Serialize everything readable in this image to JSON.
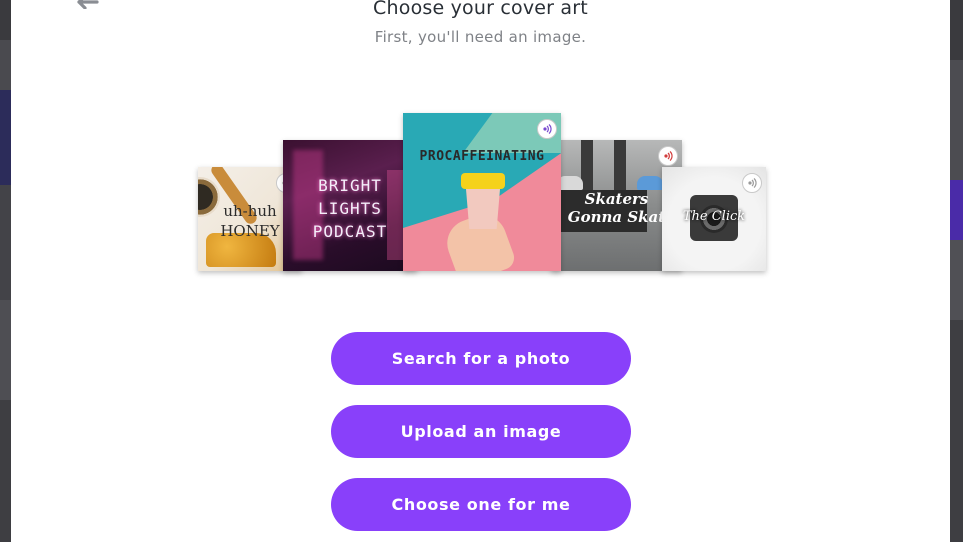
{
  "modal": {
    "title": "Choose your cover art",
    "subtitle": "First, you'll need an image."
  },
  "covers": [
    {
      "name": "honey",
      "text_lines": [
        "uh-huh",
        "HONEY"
      ]
    },
    {
      "name": "bright-lights",
      "text_lines": [
        "BRIGHT",
        "LIGHTS",
        "PODCAST"
      ]
    },
    {
      "name": "procaffeinating",
      "text_lines": [
        "PROCAFFEINATING"
      ]
    },
    {
      "name": "skaters",
      "text_lines": [
        "Skaters",
        "Gonna Skat"
      ]
    },
    {
      "name": "the-click",
      "text_lines": [
        "The Click"
      ]
    }
  ],
  "actions": {
    "search_label": "Search for a photo",
    "upload_label": "Upload an image",
    "choose_label": "Choose one for me"
  },
  "colors": {
    "accent": "#8940fa",
    "title": "#292f36",
    "subtitle": "#7f8287"
  },
  "icons": {
    "back": "arrow-left-icon",
    "badge": "anchor-podcast-icon"
  }
}
